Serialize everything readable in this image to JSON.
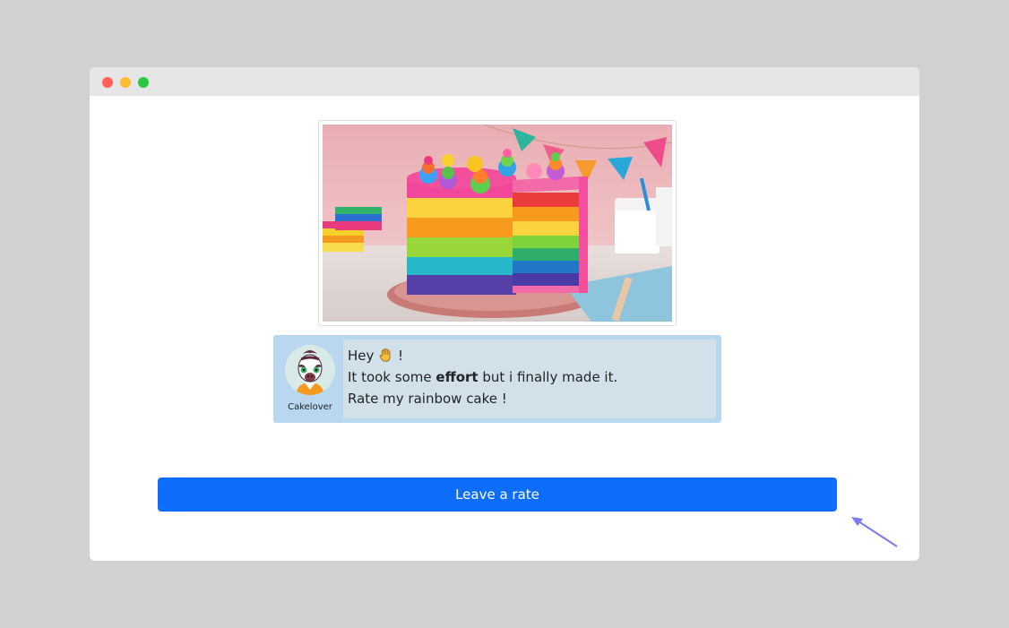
{
  "window": {
    "controls": [
      "close",
      "minimize",
      "maximize"
    ],
    "colors": {
      "close": "#ff5f57",
      "minimize": "#febc2e",
      "maximize": "#28c840"
    }
  },
  "post": {
    "image_description": "rainbow-layer-cake-photo",
    "author": "Cakelover",
    "greeting": "Hey",
    "greeting_emoji": "waving-hand",
    "greeting_end": "!",
    "line2_before": "It took some",
    "line2_bold": "effort",
    "line2_after": "but i finally made it.",
    "line3": "Rate my rainbow cake !"
  },
  "actions": {
    "rate_label": "Leave a rate"
  },
  "colors": {
    "accent": "#0d6efd",
    "message_bg": "#b9d7ee",
    "bubble_bg": "#d2e0ea",
    "cursor": "#7b7bf0"
  }
}
